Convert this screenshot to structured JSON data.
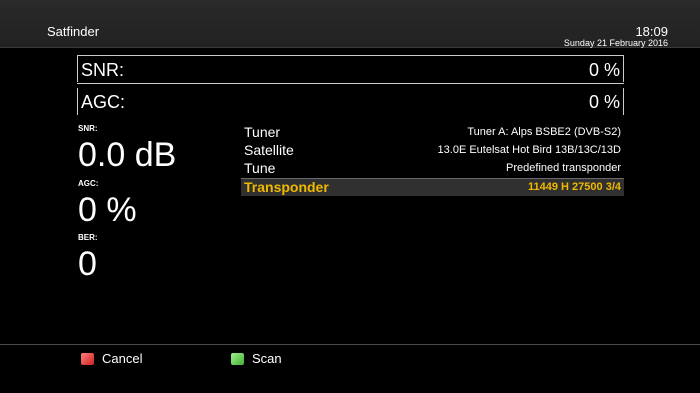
{
  "header": {
    "title": "Satfinder",
    "time": "18:09",
    "date": "Sunday 21 February 2016"
  },
  "bars": [
    {
      "label": "SNR:",
      "percent": "0 %"
    },
    {
      "label": "AGC:",
      "percent": "0 %"
    }
  ],
  "stats": {
    "snr_label": "SNR:",
    "snr_value": "0.0 dB",
    "agc_label": "AGC:",
    "agc_value": "0 %",
    "ber_label": "BER:",
    "ber_value": "0"
  },
  "settings": [
    {
      "key": "Tuner",
      "value": "Tuner A: Alps BSBE2 (DVB-S2)"
    },
    {
      "key": "Satellite",
      "value": "13.0E Eutelsat Hot Bird 13B/13C/13D"
    },
    {
      "key": "Tune",
      "value": "Predefined transponder"
    },
    {
      "key": "Transponder",
      "value": "11449 H 27500 3/4"
    }
  ],
  "buttons": {
    "cancel_label": "Cancel",
    "cancel_color": "#d02020",
    "scan_label": "Scan",
    "scan_color": "#40b030"
  },
  "colors": {
    "accent": "#f0b800"
  }
}
